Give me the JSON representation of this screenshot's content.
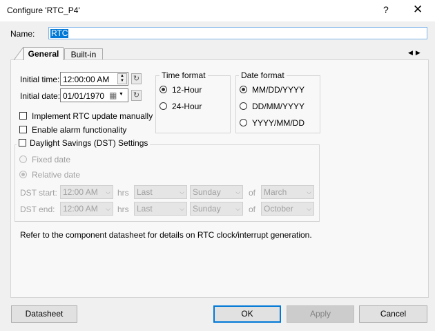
{
  "window": {
    "title": "Configure 'RTC_P4'",
    "help_label": "?",
    "close_label": "✕"
  },
  "name": {
    "label": "Name:",
    "value": "RTC"
  },
  "tabs": [
    {
      "label": "General",
      "active": true
    },
    {
      "label": "Built-in",
      "active": false
    }
  ],
  "tab_scroll": {
    "left": "◀",
    "right": "▶"
  },
  "general": {
    "initial_time": {
      "label": "Initial time:",
      "value": "12:00:00 AM"
    },
    "initial_date": {
      "label": "Initial date:",
      "value": "01/01/1970"
    },
    "time_format": {
      "title": "Time format",
      "options": [
        "12-Hour",
        "24-Hour"
      ],
      "selected": "12-Hour"
    },
    "date_format": {
      "title": "Date format",
      "options": [
        "MM/DD/YYYY",
        "DD/MM/YYYY",
        "YYYY/MM/DD"
      ],
      "selected": "MM/DD/YYYY"
    },
    "checkboxes": [
      {
        "label": "Implement RTC update manually",
        "checked": false
      },
      {
        "label": "Enable alarm functionality",
        "checked": false
      },
      {
        "label": "Daylight Savings (DST) Settings",
        "checked": false
      }
    ],
    "dst": {
      "fixed_date": "Fixed date",
      "relative_date": "Relative date",
      "start_label": "DST start:",
      "end_label": "DST end:",
      "hrs": "hrs",
      "of": "of",
      "start": {
        "time": "12:00 AM",
        "week": "Last",
        "day": "Sunday",
        "month": "March"
      },
      "end": {
        "time": "12:00 AM",
        "week": "Last",
        "day": "Sunday",
        "month": "October"
      }
    },
    "note": "Refer to the component datasheet for details on RTC clock/interrupt generation."
  },
  "footer": {
    "datasheet": "Datasheet",
    "ok": "OK",
    "apply": "Apply",
    "cancel": "Cancel"
  },
  "icons": {
    "refresh": "↻",
    "spin_up": "▲",
    "spin_down": "▼",
    "calendar": "▦",
    "chevron": "⌵"
  },
  "colors": {
    "selection": "#0078d7",
    "focus_border": "#7eb4ea"
  }
}
